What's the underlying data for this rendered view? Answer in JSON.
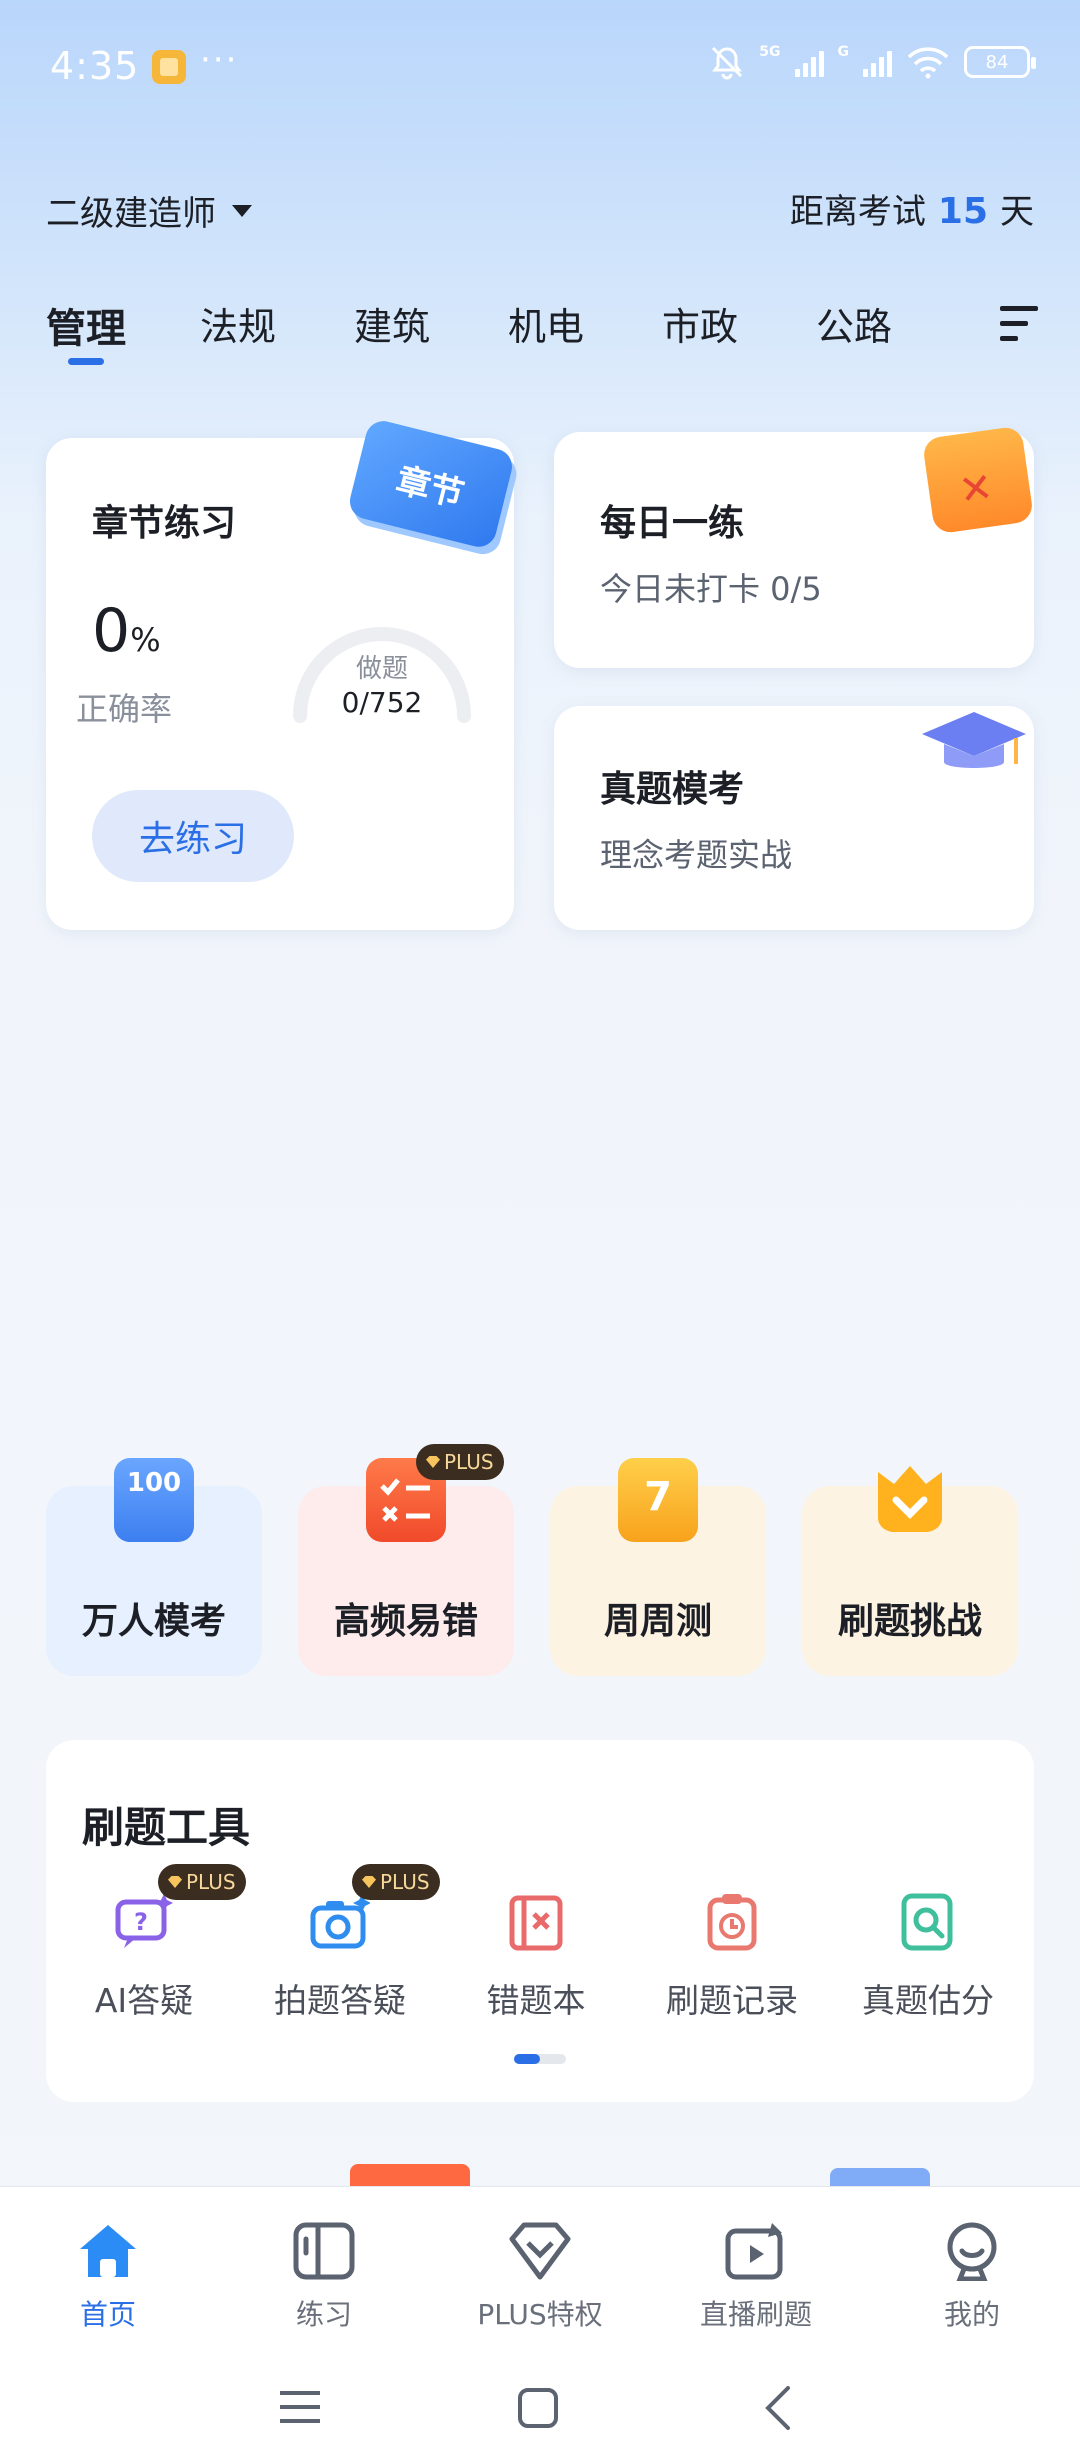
{
  "status_bar": {
    "time": "4:35",
    "more": "···",
    "battery": "84",
    "net_5g": "5G",
    "net_g": "G"
  },
  "header": {
    "exam": "二级建造师",
    "countdown_prefix": "距离考试",
    "countdown_days": "15",
    "countdown_unit": "天"
  },
  "tabs": [
    {
      "label": "管理",
      "active": true
    },
    {
      "label": "法规",
      "active": false
    },
    {
      "label": "建筑",
      "active": false
    },
    {
      "label": "机电",
      "active": false
    },
    {
      "label": "市政",
      "active": false
    },
    {
      "label": "公路",
      "active": false
    }
  ],
  "chapter_card": {
    "title": "章节练习",
    "tag": "章节",
    "accuracy_value": "0",
    "accuracy_unit": "%",
    "accuracy_label": "正确率",
    "done_label": "做题",
    "done_value": "0/752",
    "done_fraction": 0,
    "button": "去练习"
  },
  "daily_card": {
    "title": "每日一练",
    "subtitle": "今日未打卡 0/5"
  },
  "mock_card": {
    "title": "真题模考",
    "subtitle": "理念考题实战"
  },
  "features": [
    {
      "label": "万人模考",
      "icon": "exam-100-icon",
      "icon_text": "100",
      "bg": "#e6f0fe",
      "plus": false
    },
    {
      "label": "高频易错",
      "icon": "checklist-icon",
      "bg": "#fdeceb",
      "plus": true
    },
    {
      "label": "周周测",
      "icon": "calendar-7-icon",
      "icon_text": "7",
      "bg": "#fdf3e3",
      "plus": false
    },
    {
      "label": "刷题挑战",
      "icon": "crown-shield-icon",
      "bg": "#fdf3e3",
      "plus": false
    }
  ],
  "plus_badge": "PLUS",
  "tools": {
    "title": "刷题工具",
    "items": [
      {
        "label": "AI答疑",
        "icon": "ai-question-icon",
        "color": "#8a62e8",
        "plus": true
      },
      {
        "label": "拍题答疑",
        "icon": "camera-icon",
        "color": "#2f8df0",
        "plus": true
      },
      {
        "label": "错题本",
        "icon": "wrong-book-icon",
        "color": "#e96a6a",
        "plus": false
      },
      {
        "label": "刷题记录",
        "icon": "record-icon",
        "color": "#e9786e",
        "plus": false
      },
      {
        "label": "真题估分",
        "icon": "search-doc-icon",
        "color": "#3fbf9c",
        "plus": false
      }
    ]
  },
  "bottom_nav": [
    {
      "label": "首页",
      "icon": "home-icon",
      "active": true
    },
    {
      "label": "练习",
      "icon": "practice-icon",
      "active": false
    },
    {
      "label": "PLUS特权",
      "icon": "diamond-icon",
      "active": false
    },
    {
      "label": "直播刷题",
      "icon": "live-icon",
      "active": false
    },
    {
      "label": "我的",
      "icon": "profile-icon",
      "active": false
    }
  ],
  "colors": {
    "accent": "#2b6fe6",
    "text": "#1c1f26"
  }
}
